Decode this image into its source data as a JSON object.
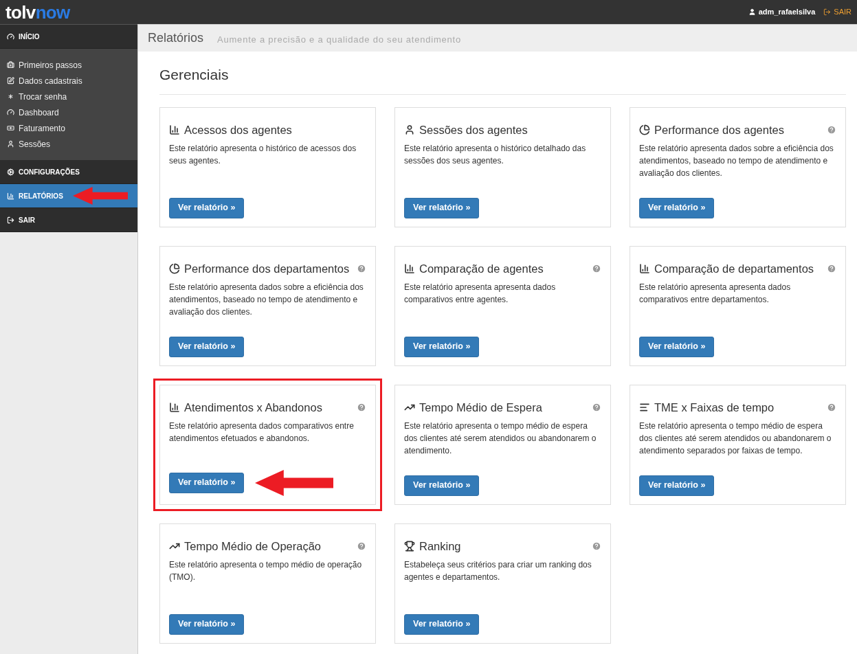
{
  "brand": {
    "part_1": "tolv",
    "part_2": "now"
  },
  "user": {
    "name": "adm_rafaelsilva",
    "logout": "SAIR"
  },
  "sidebar": {
    "sections": [
      {
        "label": "INÍCIO",
        "kind": "gauge",
        "selected": false,
        "annotated": false,
        "children": [
          {
            "label": "Primeiros passos",
            "kind": "kit"
          },
          {
            "label": "Dados cadastrais",
            "kind": "edit"
          },
          {
            "label": "Trocar senha",
            "kind": "asterisk"
          },
          {
            "label": "Dashboard",
            "kind": "gauge"
          },
          {
            "label": "Faturamento",
            "kind": "money"
          },
          {
            "label": "Sessões",
            "kind": "user"
          }
        ]
      },
      {
        "label": "CONFIGURAÇÕES",
        "kind": "cogs",
        "selected": false,
        "annotated": false
      },
      {
        "label": "RELATÓRIOS",
        "kind": "bar",
        "selected": true,
        "annotated": true
      },
      {
        "label": "SAIR",
        "kind": "logout",
        "selected": false,
        "annotated": false
      }
    ]
  },
  "page_header": {
    "title": "Relatórios",
    "subtitle": "Aumente a precisão e a qualidade do seu atendimento"
  },
  "section_title": "Gerenciais",
  "cards": [
    {
      "kind": "bar",
      "title": "Acessos dos agentes",
      "description": "Este relatório apresenta o histórico de acessos dos seus agentes.",
      "help": false,
      "annotated": false,
      "button": "Ver relatório »"
    },
    {
      "kind": "user",
      "title": "Sessões dos agentes",
      "description": "Este relatório apresenta o histórico detalhado das sessões dos seus agentes.",
      "help": false,
      "annotated": false,
      "button": "Ver relatório »"
    },
    {
      "kind": "pie",
      "title": "Performance dos agentes",
      "description": "Este relatório apresenta dados sobre a eficiência dos atendimentos, baseado no tempo de atendimento e avaliação dos clientes.",
      "help": true,
      "annotated": false,
      "button": "Ver relatório »"
    },
    {
      "kind": "pie",
      "title": "Performance dos departamentos",
      "description": "Este relatório apresenta dados sobre a eficiência dos atendimentos, baseado no tempo de atendimento e avaliação dos clientes.",
      "help": true,
      "annotated": false,
      "button": "Ver relatório »"
    },
    {
      "kind": "bar",
      "title": "Comparação de agentes",
      "description": "Este relatório apresenta apresenta dados comparativos entre agentes.",
      "help": true,
      "annotated": false,
      "button": "Ver relatório »"
    },
    {
      "kind": "bar",
      "title": "Comparação de departamentos",
      "description": "Este relatório apresenta apresenta dados comparativos entre departamentos.",
      "help": true,
      "annotated": false,
      "button": "Ver relatório »"
    },
    {
      "kind": "bar",
      "title": "Atendimentos x Abandonos",
      "description": "Este relatório apresenta dados comparativos entre atendimentos efetuados e abandonos.",
      "help": true,
      "annotated": true,
      "button": "Ver relatório »"
    },
    {
      "kind": "line",
      "title": "Tempo Médio de Espera",
      "description": "Este relatório apresenta o tempo médio de espera dos clientes até serem atendidos ou abandonarem o atendimento.",
      "help": true,
      "annotated": false,
      "button": "Ver relatório »"
    },
    {
      "kind": "lines",
      "title": "TME x Faixas de tempo",
      "description": "Este relatório apresenta o tempo médio de espera dos clientes até serem atendidos ou abandonarem o atendimento separados por faixas de tempo.",
      "help": true,
      "annotated": false,
      "button": "Ver relatório »"
    },
    {
      "kind": "line",
      "title": "Tempo Médio de Operação",
      "description": "Este relatório apresenta o tempo médio de operação (TMO).",
      "help": true,
      "annotated": false,
      "button": "Ver relatório »"
    },
    {
      "kind": "trophy",
      "title": "Ranking",
      "description": "Estabeleça seus critérios para criar um ranking dos agentes e departamentos.",
      "help": true,
      "annotated": false,
      "button": "Ver relatório »"
    }
  ]
}
